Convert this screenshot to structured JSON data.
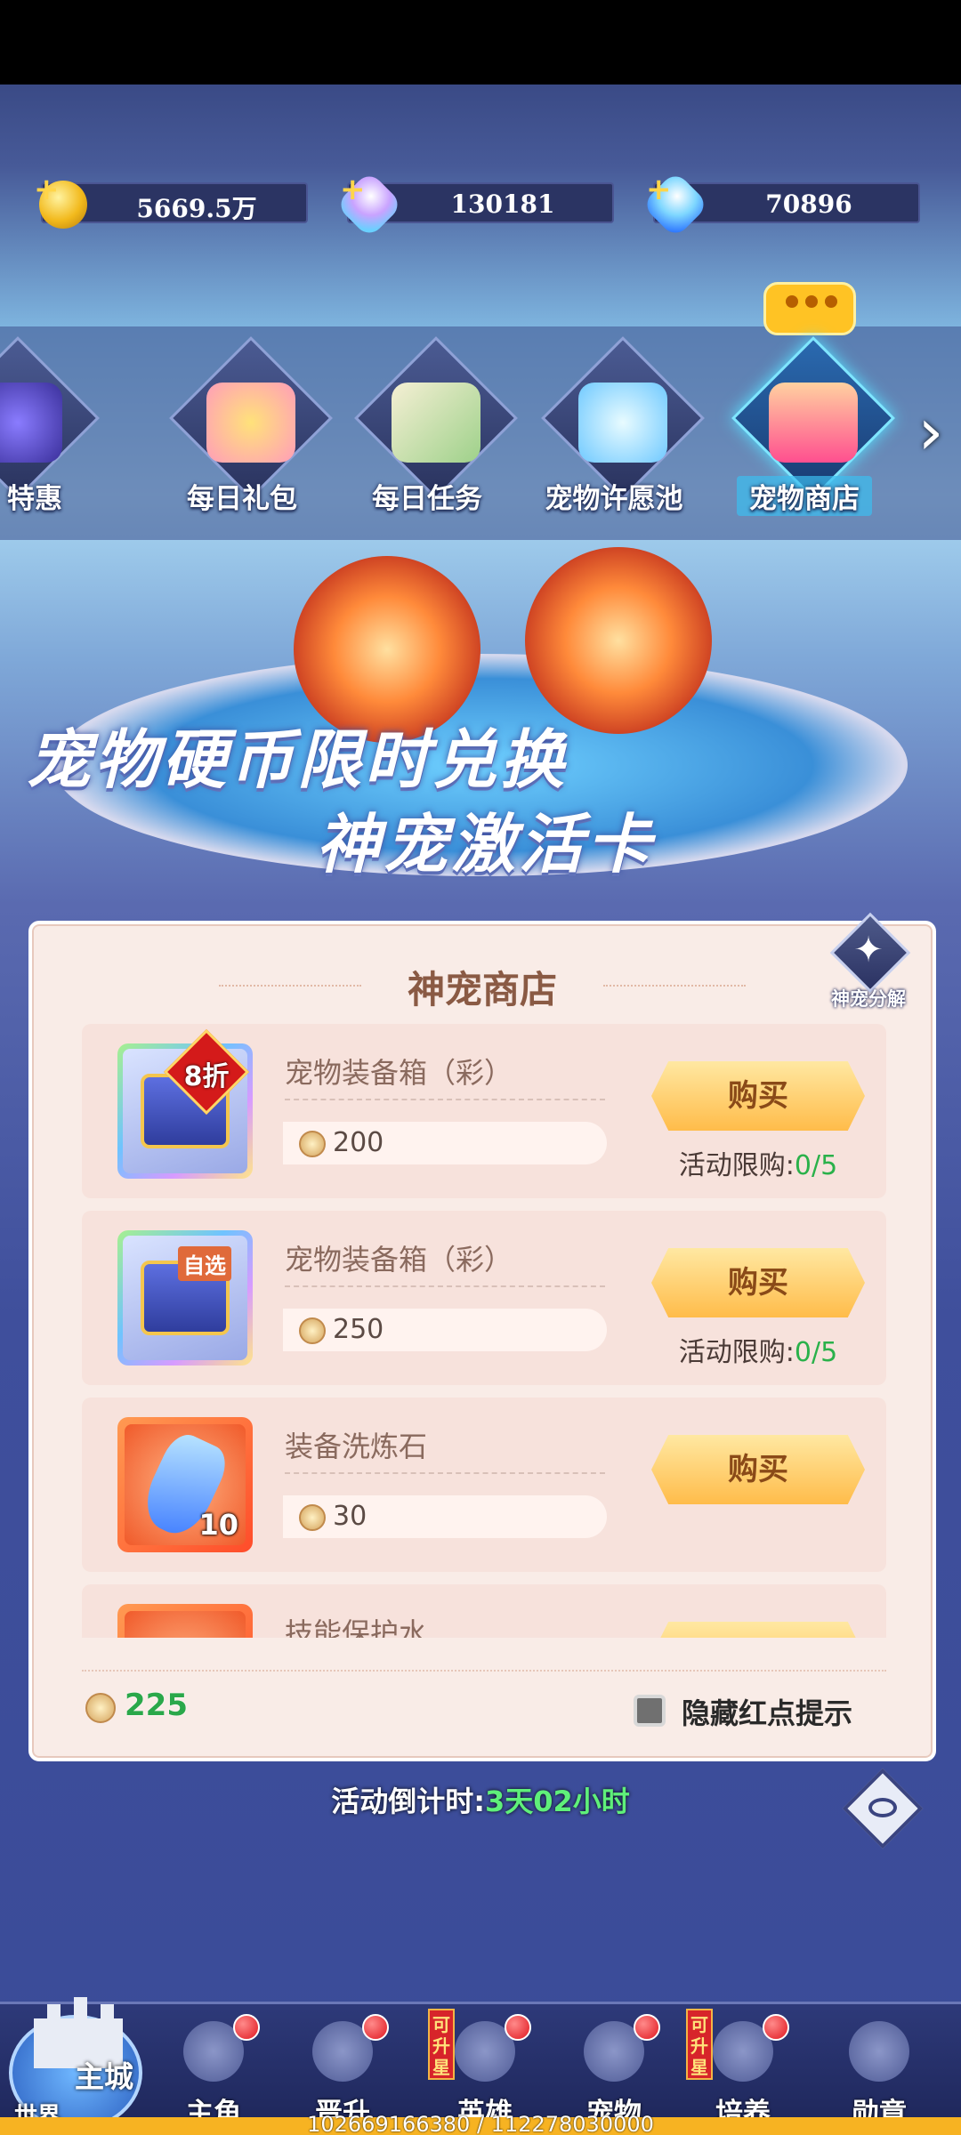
{
  "resources": [
    {
      "icon": "gold-coin-icon",
      "value": "5669.5万"
    },
    {
      "icon": "rainbow-gem-icon",
      "value": "130181"
    },
    {
      "icon": "blue-diamond-icon",
      "value": "70896"
    }
  ],
  "nav_tabs": [
    {
      "label": "特惠",
      "icon": "bag-icon"
    },
    {
      "label": "每日礼包",
      "icon": "gift-box-icon"
    },
    {
      "label": "每日任务",
      "icon": "scroll-icon"
    },
    {
      "label": "宠物许愿池",
      "icon": "wishing-orb-icon"
    },
    {
      "label": "宠物商店",
      "icon": "shop-icon",
      "selected": true
    }
  ],
  "banner": {
    "line1": "宠物硬币限时兑换",
    "line2": "神宠激活卡"
  },
  "shop": {
    "title": "神宠商店",
    "decompose_label": "神宠分解",
    "items": [
      {
        "name": "宠物装备箱（彩）",
        "price": "200",
        "badge": "8折",
        "limit_label": "活动限购:",
        "limit_value": "0/5",
        "buy_label": "购买"
      },
      {
        "name": "宠物装备箱（彩）",
        "price": "250",
        "tag": "自选",
        "limit_label": "活动限购:",
        "limit_value": "0/5",
        "buy_label": "购买"
      },
      {
        "name": "装备洗炼石",
        "price": "30",
        "qty": "10",
        "buy_label": "购买"
      },
      {
        "name": "技能保护水"
      }
    ],
    "balance": "225",
    "hide_red_dot_label": "隐藏红点提示"
  },
  "countdown": {
    "label": "活动倒计时:",
    "value": "3天02小时"
  },
  "bottom_nav": {
    "world_top": "主城",
    "world_bottom": "世界",
    "items": [
      {
        "label": "主角",
        "dot": true
      },
      {
        "label": "晋升",
        "dot": true
      },
      {
        "label": "英雄",
        "dot": true,
        "upgrade_tag": "可升星"
      },
      {
        "label": "宠物",
        "dot": true
      },
      {
        "label": "培养",
        "dot": true,
        "upgrade_tag": "可升星"
      },
      {
        "label": "勋章"
      }
    ]
  },
  "exp_text": "102669166380 / 112278030000",
  "colors": {
    "accent_green": "#2ab14a",
    "buy_button": "#ffbc4a",
    "panel_bg": "#f9ece7",
    "selected_tab": "#58e0ff"
  }
}
